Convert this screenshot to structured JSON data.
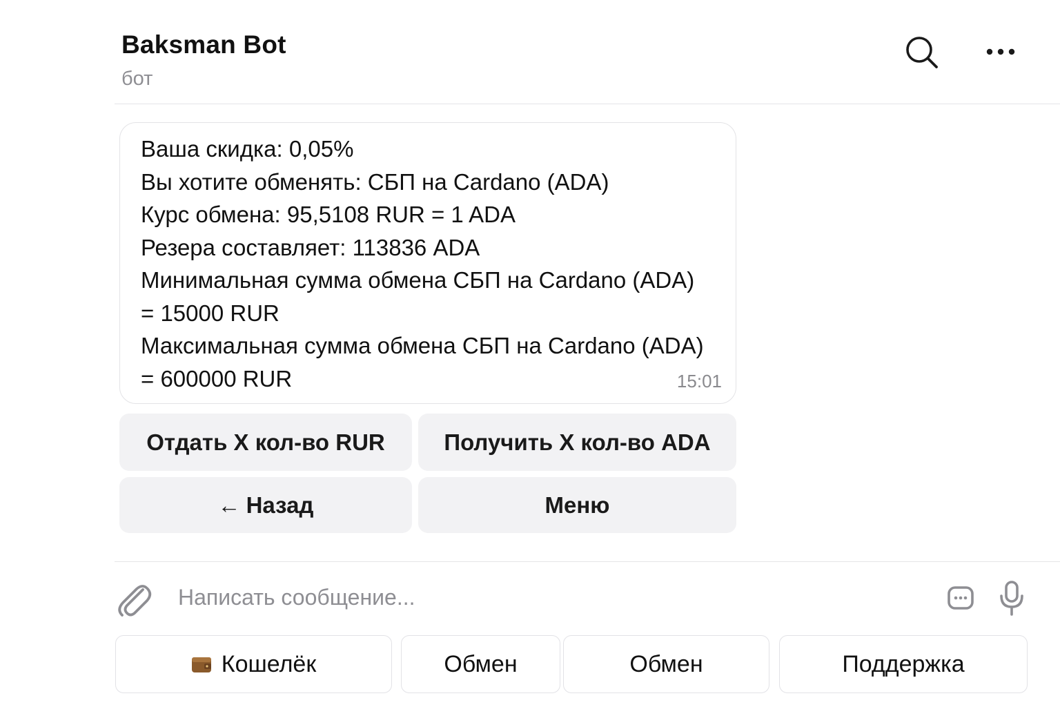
{
  "header": {
    "title": "Baksman Bot",
    "subtitle": "бот",
    "icons": [
      "search-icon",
      "more-icon"
    ]
  },
  "message": {
    "lines": [
      "Ваша скидка: 0,05%",
      "Вы хотите обменять: СБП на Cardano (ADA)",
      "Курс обмена: 95,5108 RUR = 1 ADA",
      "Резера составляет: 113836 ADA",
      "Минимальная сумма обмена СБП на Cardano (ADA)",
      "= 15000 RUR",
      "Максимальная сумма обмена СБП на Cardano (ADA)",
      "= 600000 RUR"
    ],
    "time": "15:01"
  },
  "inline_keyboard": {
    "give_label": "Отдать X кол-во RUR",
    "receive_label": "Получить X кол-во ADA",
    "back_arrow": "←",
    "back_label": "Назад",
    "menu_label": "Меню"
  },
  "composer": {
    "placeholder": "Написать сообщение...",
    "icons": [
      "paperclip-icon",
      "sticker-icon",
      "microphone-icon"
    ]
  },
  "reply_keyboard": {
    "wallet_label": "Кошелёк",
    "wallet_icon": "wallet-icon",
    "exchange_label_1": "Обмен",
    "exchange_label_2": "Обмен",
    "support_label": "Поддержка"
  },
  "colors": {
    "text": "#111111",
    "secondary_text": "#8e8e93",
    "button_bg": "#f2f2f4",
    "border": "#e3e3e6"
  }
}
